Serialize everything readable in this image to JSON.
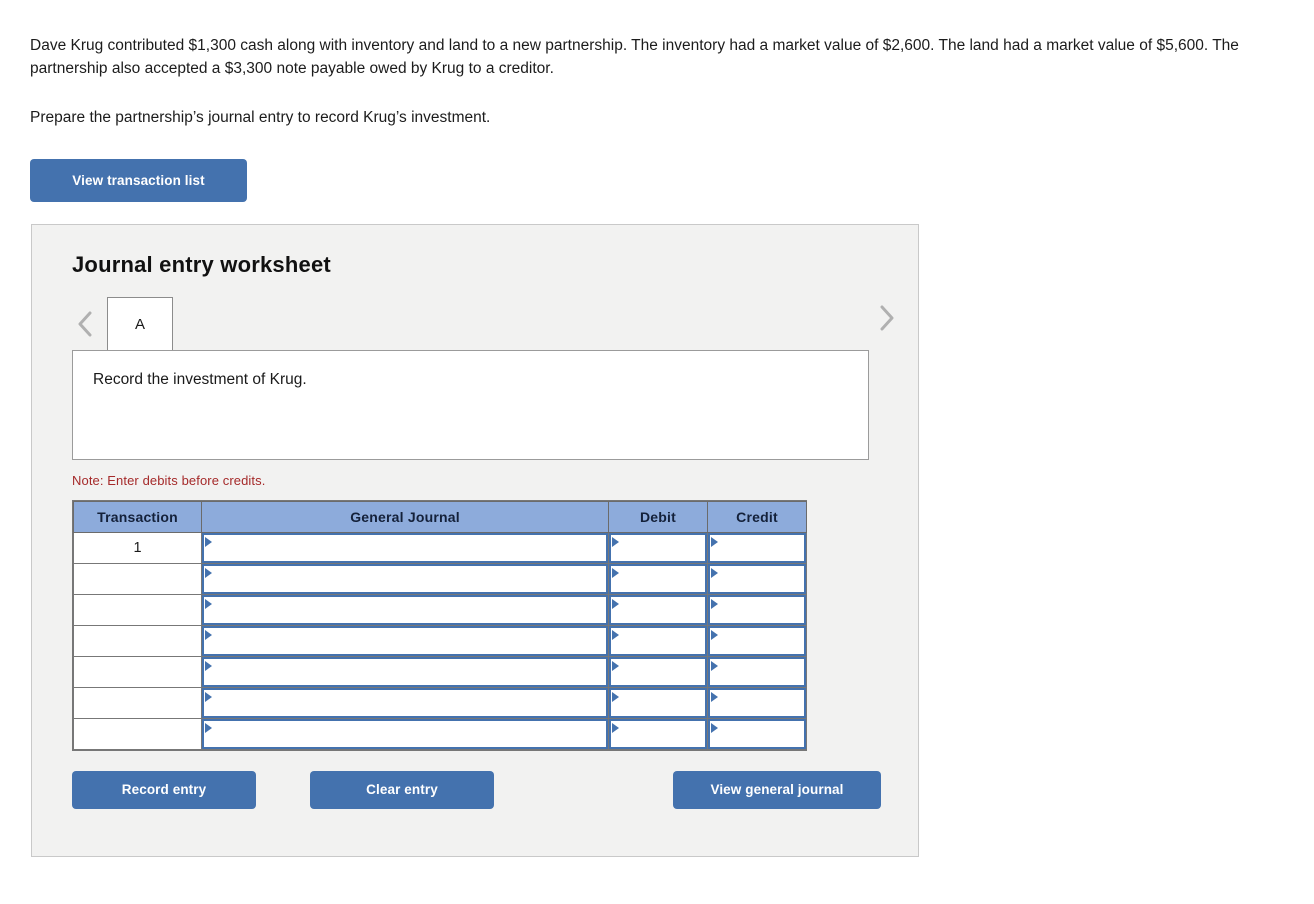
{
  "problem": {
    "paragraph_1": "Dave Krug contributed $1,300 cash along with inventory and land to a new partnership. The inventory had a market value of $2,600. The land had a market value of $5,600. The partnership also accepted a $3,300 note payable owed by Krug to a creditor.",
    "paragraph_2": "Prepare the partnership’s journal entry to record Krug’s investment."
  },
  "toolbar": {
    "view_transaction_list_label": "View transaction list"
  },
  "worksheet": {
    "title": "Journal entry worksheet",
    "prev_icon": "chevron-left-icon",
    "next_icon": "chevron-right-icon",
    "tabs": [
      {
        "label": "A",
        "selected": true
      }
    ],
    "description": "Record the investment of Krug.",
    "note": "Note: Enter debits before credits.",
    "table": {
      "columns": [
        "Transaction",
        "General Journal",
        "Debit",
        "Credit"
      ],
      "rows": [
        {
          "transaction": "1",
          "general_journal": "",
          "debit": "",
          "credit": ""
        },
        {
          "transaction": "",
          "general_journal": "",
          "debit": "",
          "credit": ""
        },
        {
          "transaction": "",
          "general_journal": "",
          "debit": "",
          "credit": ""
        },
        {
          "transaction": "",
          "general_journal": "",
          "debit": "",
          "credit": ""
        },
        {
          "transaction": "",
          "general_journal": "",
          "debit": "",
          "credit": ""
        },
        {
          "transaction": "",
          "general_journal": "",
          "debit": "",
          "credit": ""
        },
        {
          "transaction": "",
          "general_journal": "",
          "debit": "",
          "credit": ""
        }
      ]
    },
    "buttons": {
      "record_entry_label": "Record entry",
      "clear_entry_label": "Clear entry",
      "view_general_journal_label": "View general journal"
    }
  },
  "colors": {
    "button_blue": "#4472ae",
    "table_header_blue": "#8dabdb",
    "panel_bg": "#f2f2f1",
    "note_red": "#a52a2a"
  }
}
